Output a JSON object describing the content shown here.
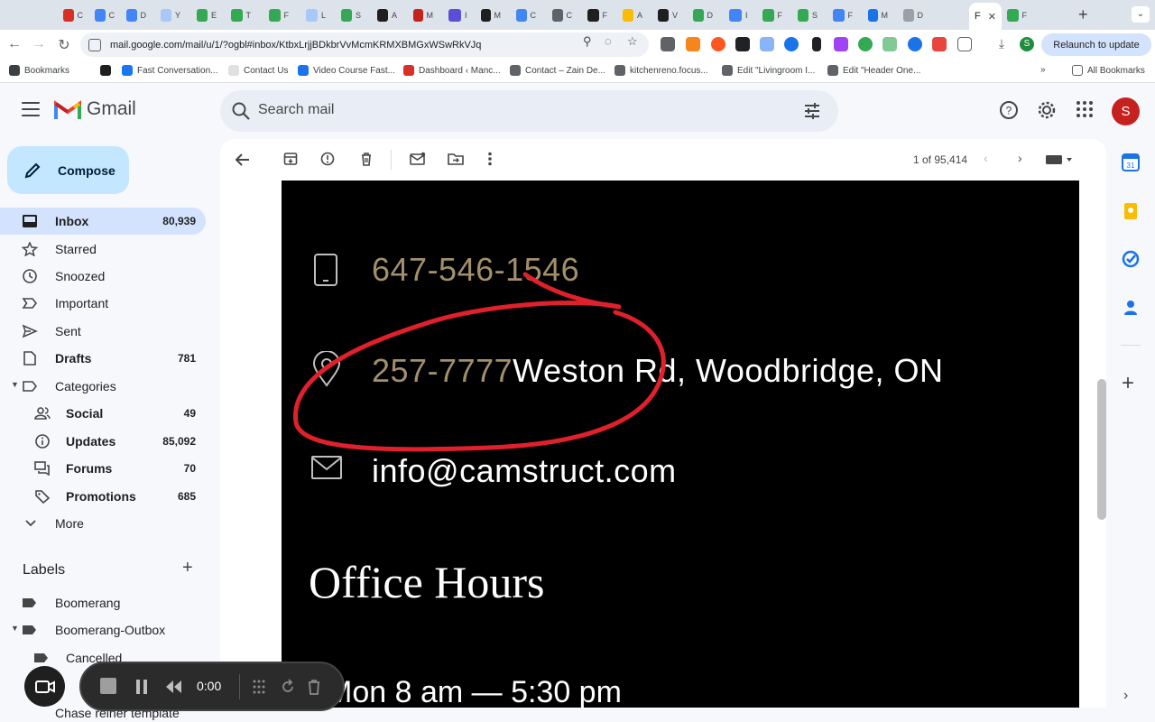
{
  "browser": {
    "tabs": [
      {
        "short": "C",
        "color": "#d93025"
      },
      {
        "short": "C",
        "color": "#4285f4"
      },
      {
        "short": "D",
        "color": "#4285f4"
      },
      {
        "short": "Y",
        "color": "#a8c7fa"
      },
      {
        "short": "E",
        "color": "#34a853"
      },
      {
        "short": "T",
        "color": "#34a853"
      },
      {
        "short": "F",
        "color": "#34a853"
      },
      {
        "short": "L",
        "color": "#a8c7fa"
      },
      {
        "short": "S",
        "color": "#34a853"
      },
      {
        "short": "A",
        "color": "#1f1f1f"
      },
      {
        "short": "M",
        "color": "#c5221f"
      },
      {
        "short": "I",
        "color": "#5b4fd8"
      },
      {
        "short": "M",
        "color": "#1f1f1f"
      },
      {
        "short": "C",
        "color": "#4285f4"
      },
      {
        "short": "C",
        "color": "#5f6368"
      },
      {
        "short": "F",
        "color": "#1f1f1f"
      },
      {
        "short": "A",
        "color": "#fbbc04"
      },
      {
        "short": "V",
        "color": "#1f1f1f"
      },
      {
        "short": "D",
        "color": "#34a853"
      },
      {
        "short": "I",
        "color": "#4285f4"
      },
      {
        "short": "F",
        "color": "#34a853"
      },
      {
        "short": "S",
        "color": "#34a853"
      },
      {
        "short": "F",
        "color": "#4285f4"
      },
      {
        "short": "M",
        "color": "#1a73e8"
      },
      {
        "short": "D",
        "color": "#9aa0a6"
      },
      {
        "short": "F",
        "color": "#34a853"
      }
    ],
    "active_tab": "F",
    "new_tab": "+",
    "url": "mail.google.com/mail/u/1/?ogbl#inbox/KtbxLrjjBDkbrVvMcmKRMXBMGxWSwRkVJq",
    "relaunch_label": "Relaunch to update",
    "profile_initial": "S",
    "bookmarks": [
      {
        "label": "Bookmarks",
        "icon": "star-icon"
      },
      {
        "label": "",
        "icon": "app-icon"
      },
      {
        "label": "Fast Conversation...",
        "icon": "facebook-icon"
      },
      {
        "label": "Contact Us",
        "icon": "page-icon"
      },
      {
        "label": "Video Course Fast...",
        "icon": "page-icon"
      },
      {
        "label": "Dashboard ‹ Manc...",
        "icon": "page-icon"
      },
      {
        "label": "Contact – Zain De...",
        "icon": "page-icon"
      },
      {
        "label": "kitchenreno.focus...",
        "icon": "page-icon"
      },
      {
        "label": "Edit \"Livingroom I...",
        "icon": "page-icon"
      },
      {
        "label": "Edit \"Header One...",
        "icon": "page-icon"
      }
    ],
    "all_bookmarks": "All Bookmarks"
  },
  "gmail": {
    "logo_text": "Gmail",
    "search_placeholder": "Search mail",
    "avatar_initial": "S",
    "compose_label": "Compose",
    "nav": [
      {
        "label": "Inbox",
        "count": "80,939",
        "icon": "inbox-icon",
        "active": true,
        "bold": true
      },
      {
        "label": "Starred",
        "count": "",
        "icon": "star-icon"
      },
      {
        "label": "Snoozed",
        "count": "",
        "icon": "clock-icon"
      },
      {
        "label": "Important",
        "count": "",
        "icon": "label-important-icon"
      },
      {
        "label": "Sent",
        "count": "",
        "icon": "send-icon"
      },
      {
        "label": "Drafts",
        "count": "781",
        "icon": "draft-icon",
        "bold": true
      },
      {
        "label": "Categories",
        "count": "",
        "icon": "label-outline-icon",
        "caret": true
      },
      {
        "label": "Social",
        "count": "49",
        "icon": "people-icon",
        "bold": true
      },
      {
        "label": "Updates",
        "count": "85,092",
        "icon": "info-icon",
        "bold": true
      },
      {
        "label": "Forums",
        "count": "70",
        "icon": "forum-icon",
        "bold": true
      },
      {
        "label": "Promotions",
        "count": "685",
        "icon": "tag-icon",
        "bold": true
      },
      {
        "label": "More",
        "count": "",
        "icon": "chevron-down-icon"
      }
    ],
    "labels_title": "Labels",
    "labels": [
      {
        "label": "Boomerang",
        "icon": "label-icon"
      },
      {
        "label": "Boomerang-Outbox",
        "icon": "label-icon",
        "caret": true
      },
      {
        "label": "Cancelled",
        "icon": "label-icon"
      }
    ],
    "below_label": "Chase reiner template",
    "pager": "1 of 95,414"
  },
  "email": {
    "phone": "647-546-1546",
    "address_number": "257-7777",
    "address_street": "Weston Rd, Woodbridge, ON",
    "email": "info@camstruct.com",
    "office_hours_title": "Office Hours",
    "hours_line": "Mon 8 am — 5:30 pm",
    "accent_color": "#a38f6a",
    "annotation_color": "#e0202a"
  },
  "recorder": {
    "time": "0:00"
  }
}
